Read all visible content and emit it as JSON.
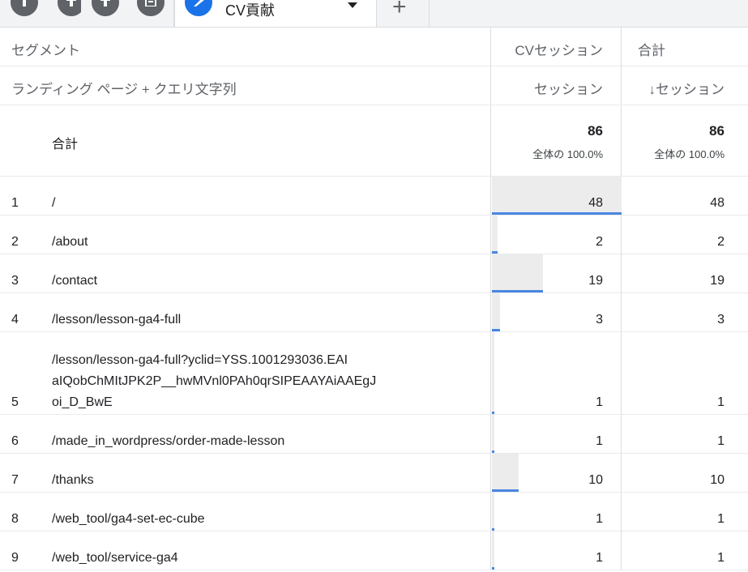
{
  "tabs": {
    "icon_tabs": [
      "bar-chart-icon",
      "bar-chart-icon",
      "table-icon"
    ],
    "active_label": "CV貢献",
    "active_icon": "pencil-icon",
    "add_icon": "plus-icon"
  },
  "header": {
    "segment_label": "セグメント",
    "cv_segment": "CVセッション",
    "total_segment": "合計",
    "dimension_label": "ランディング ページ + クエリ文字列",
    "cv_metric": "セッション",
    "total_metric": "↓セッション"
  },
  "totals": {
    "label": "合計",
    "cv_value": "86",
    "cv_pct": "全体の 100.0%",
    "total_value": "86",
    "total_pct": "全体の 100.0%"
  },
  "rows": [
    {
      "index": "1",
      "path": "/",
      "cv": "48",
      "total": "48",
      "share": 1.0
    },
    {
      "index": "2",
      "path": "/about",
      "cv": "2",
      "total": "2",
      "share": 0.042
    },
    {
      "index": "3",
      "path": "/contact",
      "cv": "19",
      "total": "19",
      "share": 0.396
    },
    {
      "index": "4",
      "path": "/lesson/lesson-ga4-full",
      "cv": "3",
      "total": "3",
      "share": 0.063
    },
    {
      "index": "5",
      "path": "/lesson/lesson-ga4-full?yclid=YSS.1001293036.EAI\naIQobChMItJPK2P__hwMVnl0PAh0qrSIPEAAYAiAAEgJ\noi_D_BwE",
      "cv": "1",
      "total": "1",
      "share": 0.021
    },
    {
      "index": "6",
      "path": "/made_in_wordpress/order-made-lesson",
      "cv": "1",
      "total": "1",
      "share": 0.021
    },
    {
      "index": "7",
      "path": "/thanks",
      "cv": "10",
      "total": "10",
      "share": 0.208
    },
    {
      "index": "8",
      "path": "/web_tool/ga4-set-ec-cube",
      "cv": "1",
      "total": "1",
      "share": 0.021
    },
    {
      "index": "9",
      "path": "/web_tool/service-ga4",
      "cv": "1",
      "total": "1",
      "share": 0.021
    }
  ],
  "colors": {
    "bar_fill": "#ececec",
    "bar_line": "#4a86e0",
    "active_tab_icon": "#1a73e8"
  }
}
